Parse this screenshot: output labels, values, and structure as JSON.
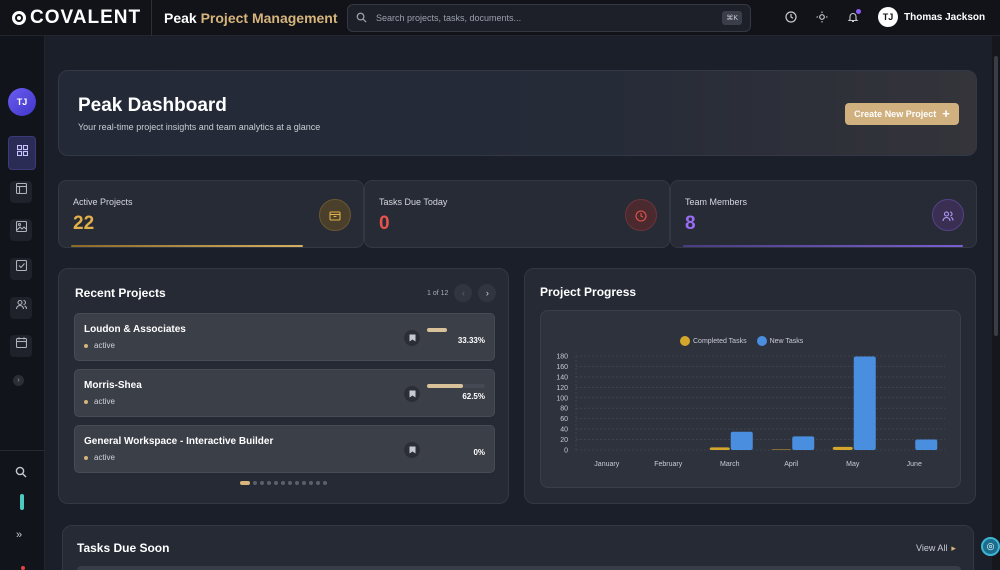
{
  "header": {
    "brand": "COVALENT",
    "app_title_prefix": "Peak",
    "app_title_accent": "Project Management",
    "search_placeholder": "Search projects, tasks, documents...",
    "search_shortcut": "⌘K",
    "user_initials": "TJ",
    "user_name": "Thomas Jackson"
  },
  "sidebar": {
    "avatar_initials": "TJ"
  },
  "hero": {
    "title": "Peak Dashboard",
    "subtitle": "Your real-time project insights and team analytics at a glance",
    "button_label": "Create New Project"
  },
  "stats": [
    {
      "label": "Active Projects",
      "value": "22",
      "color": "#e1b04a"
    },
    {
      "label": "Tasks Due Today",
      "value": "0",
      "color": "#e5534b"
    },
    {
      "label": "Team Members",
      "value": "8",
      "color": "#9a6cf6"
    }
  ],
  "recent_projects": {
    "title": "Recent Projects",
    "pager_text": "1 of 12",
    "items": [
      {
        "name": "Loudon & Associates",
        "status": "active",
        "progress_pct": 33.33,
        "progress_label": "33.33%"
      },
      {
        "name": "Morris-Shea",
        "status": "active",
        "progress_pct": 62.5,
        "progress_label": "62.5%"
      },
      {
        "name": "General Workspace - Interactive Builder",
        "status": "active",
        "progress_pct": 0,
        "progress_label": "0%"
      }
    ],
    "page_count": 12,
    "current_page": 1
  },
  "progress": {
    "title": "Project Progress"
  },
  "chart_data": {
    "type": "bar",
    "categories": [
      "January",
      "February",
      "March",
      "April",
      "May",
      "June"
    ],
    "series": [
      {
        "name": "Completed Tasks",
        "color": "#d4a72c",
        "values": [
          0,
          0,
          5,
          1,
          6,
          0
        ]
      },
      {
        "name": "New Tasks",
        "color": "#4a8ee0",
        "values": [
          0,
          0,
          35,
          26,
          179,
          20
        ]
      }
    ],
    "yticks": [
      0,
      20,
      40,
      60,
      80,
      100,
      120,
      140,
      160,
      180
    ],
    "ylim": [
      0,
      180
    ],
    "grid": true,
    "legend_position": "top"
  },
  "tasks": {
    "title": "Tasks Due Soon",
    "view_all_label": "View All"
  }
}
